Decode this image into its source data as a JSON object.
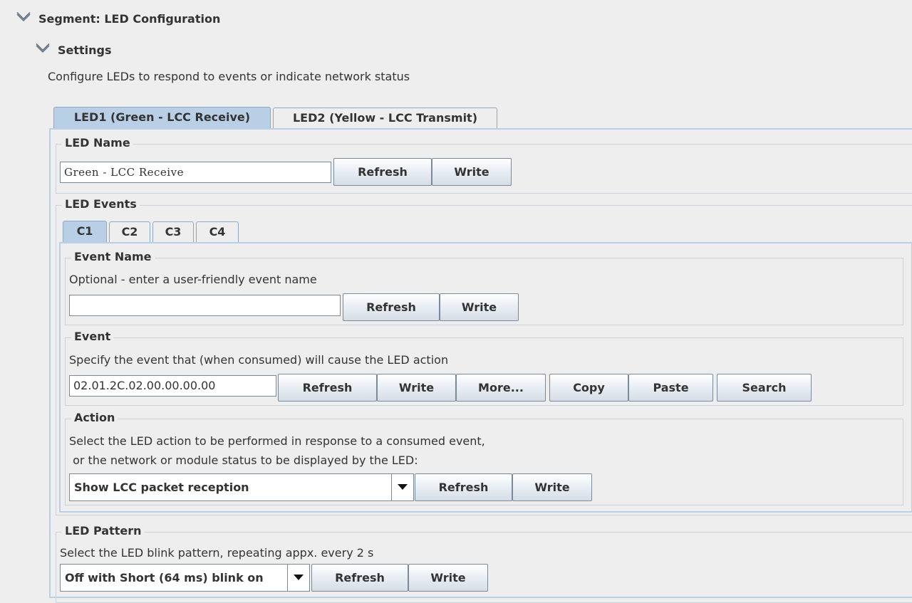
{
  "segment": {
    "title": "Segment: LED Configuration",
    "settings": {
      "title": "Settings",
      "description": "Configure LEDs to respond to events or indicate network status"
    }
  },
  "led_tabs": [
    {
      "label": "LED1 (Green - LCC Receive)",
      "active": true
    },
    {
      "label": "LED2 (Yellow - LCC Transmit)",
      "active": false
    }
  ],
  "led_name": {
    "title": "LED Name",
    "value": "Green - LCC Receive",
    "refresh_label": "Refresh",
    "write_label": "Write"
  },
  "led_events": {
    "title": "LED Events",
    "tabs": [
      "C1",
      "C2",
      "C3",
      "C4"
    ],
    "active_tab": "C1",
    "event_name": {
      "title": "Event Name",
      "description": "Optional - enter a user-friendly event name",
      "value": "",
      "refresh_label": "Refresh",
      "write_label": "Write"
    },
    "event": {
      "title": "Event",
      "description": "Specify the event that (when consumed) will cause the LED action",
      "value": "02.01.2C.02.00.00.00.00",
      "refresh_label": "Refresh",
      "write_label": "Write",
      "more_label": "More...",
      "copy_label": "Copy",
      "paste_label": "Paste",
      "search_label": "Search"
    },
    "action": {
      "title": "Action",
      "description_line1": "Select the LED action to be performed in response to a consumed event,",
      "description_line2": " or the network or module status to be displayed by the LED:",
      "selected": "Show LCC packet reception",
      "refresh_label": "Refresh",
      "write_label": "Write"
    }
  },
  "led_pattern": {
    "title": "LED Pattern",
    "description": "Select the LED blink pattern, repeating appx. every 2 s",
    "selected": "Off with Short (64 ms) blink on",
    "refresh_label": "Refresh",
    "write_label": "Write"
  },
  "colors": {
    "background": "#eeeeee",
    "tab_active": "#b8cfe5",
    "panel_frame": "#b8cfe5"
  }
}
